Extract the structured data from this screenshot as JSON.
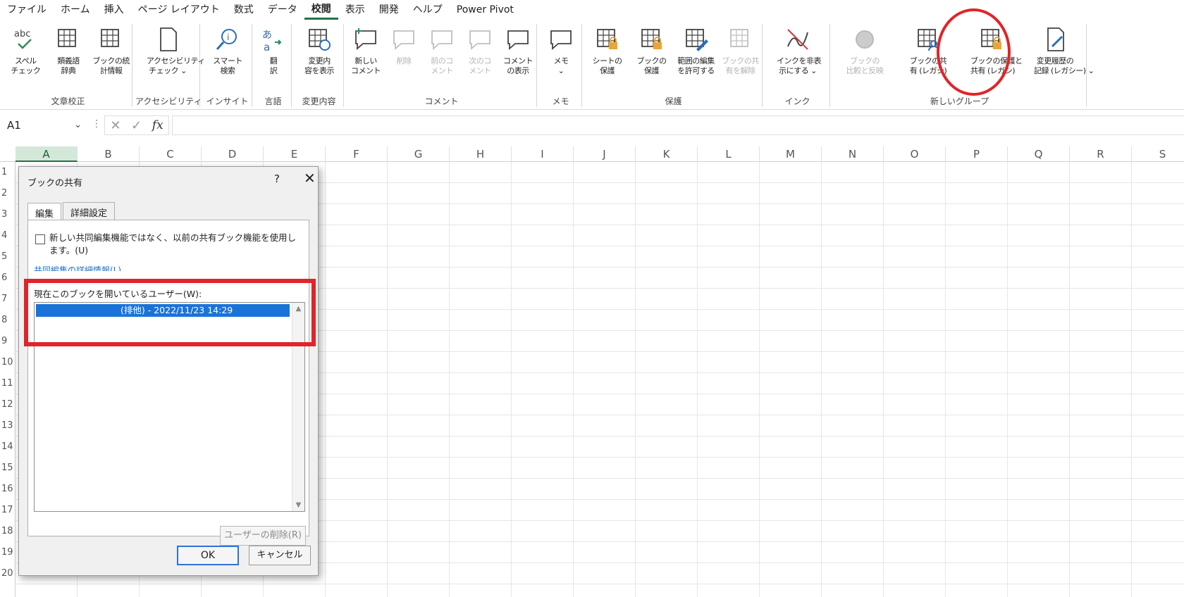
{
  "menubar": {
    "tabs": [
      "ファイル",
      "ホーム",
      "挿入",
      "ページ レイアウト",
      "数式",
      "データ",
      "校閲",
      "表示",
      "開発",
      "ヘルプ",
      "Power Pivot"
    ],
    "active_tab": "校閲"
  },
  "ribbon": {
    "groups": [
      {
        "label": "文章校正",
        "buttons": [
          {
            "label1": "スペル",
            "label2": "チェック",
            "icon": "abc-check-icon"
          },
          {
            "label1": "類義語",
            "label2": "辞典",
            "icon": "thesaurus-icon"
          },
          {
            "label1": "ブックの統",
            "label2": "計情報",
            "icon": "workbook-stats-icon"
          }
        ]
      },
      {
        "label": "アクセシビリティ",
        "buttons": [
          {
            "label1": "アクセシビリティ",
            "label2": "チェック ⌄",
            "icon": "accessibility-icon"
          }
        ]
      },
      {
        "label": "インサイト",
        "buttons": [
          {
            "label1": "スマート",
            "label2": "検索",
            "icon": "smart-lookup-icon"
          }
        ]
      },
      {
        "label": "言語",
        "buttons": [
          {
            "label1": "翻",
            "label2": "訳",
            "icon": "translate-icon"
          }
        ]
      },
      {
        "label": "変更内容",
        "buttons": [
          {
            "label1": "変更内",
            "label2": "容を表示",
            "icon": "show-changes-icon"
          }
        ]
      },
      {
        "label": "コメント",
        "buttons": [
          {
            "label1": "新しい",
            "label2": "コメント",
            "icon": "new-comment-icon"
          },
          {
            "label1": "削除",
            "label2": "",
            "icon": "delete-comment-icon",
            "disabled": true
          },
          {
            "label1": "前のコ",
            "label2": "メント",
            "icon": "prev-comment-icon",
            "disabled": true
          },
          {
            "label1": "次のコ",
            "label2": "メント",
            "icon": "next-comment-icon",
            "disabled": true
          },
          {
            "label1": "コメント",
            "label2": "の表示",
            "icon": "show-comments-icon"
          }
        ]
      },
      {
        "label": "メモ",
        "buttons": [
          {
            "label1": "メモ",
            "label2": "⌄",
            "icon": "notes-icon"
          }
        ]
      },
      {
        "label": "保護",
        "buttons": [
          {
            "label1": "シートの",
            "label2": "保護",
            "icon": "protect-sheet-icon"
          },
          {
            "label1": "ブックの",
            "label2": "保護",
            "icon": "protect-workbook-icon"
          },
          {
            "label1": "範囲の編集",
            "label2": "を許可する",
            "icon": "allow-edit-ranges-icon"
          },
          {
            "label1": "ブックの共",
            "label2": "有を解除",
            "icon": "unshare-workbook-icon",
            "disabled": true
          }
        ]
      },
      {
        "label": "インク",
        "buttons": [
          {
            "label1": "インクを非表",
            "label2": "示にする ⌄",
            "icon": "hide-ink-icon"
          }
        ]
      },
      {
        "label": "新しいグループ",
        "buttons": [
          {
            "label1": "ブックの",
            "label2": "比較と反映",
            "icon": "compare-merge-icon",
            "disabled": true
          },
          {
            "label1": "ブックの共",
            "label2": "有 (レガシ)",
            "icon": "share-workbook-legacy-icon"
          },
          {
            "label1": "ブックの保護と",
            "label2": "共有 (レガシ)",
            "icon": "protect-share-legacy-icon"
          },
          {
            "label1": "変更履歴の",
            "label2": "記録 (レガシー) ⌄",
            "icon": "track-changes-legacy-icon"
          }
        ]
      }
    ]
  },
  "formula_bar": {
    "name_box": "A1",
    "fx": "fx",
    "value": ""
  },
  "grid": {
    "columns": [
      "A",
      "B",
      "C",
      "D",
      "E",
      "F",
      "G",
      "H",
      "I",
      "J",
      "K",
      "L",
      "M",
      "N",
      "O",
      "P",
      "Q",
      "R",
      "S"
    ],
    "rows": [
      "1",
      "2",
      "3",
      "4",
      "5",
      "6",
      "7",
      "8",
      "9",
      "10",
      "11",
      "12",
      "13",
      "14",
      "15",
      "16",
      "17",
      "18",
      "19",
      "20"
    ]
  },
  "dialog": {
    "title": "ブックの共有",
    "help": "?",
    "close": "✕",
    "tabs": [
      "編集",
      "詳細設定"
    ],
    "checkbox_label": "新しい共同編集機能ではなく、以前の共有ブック機能を使用します。(U)",
    "link": "共同編集の詳細情報(L)",
    "users_label": "現在このブックを開いているユーザー(W):",
    "users": [
      "(排他) - 2022/11/23 14:29"
    ],
    "remove_user": "ユーザーの削除(R)",
    "ok": "OK",
    "cancel": "キャンセル"
  },
  "colors": {
    "accent": "#217346",
    "highlight_red": "#e0242a",
    "selection_blue": "#1a73d9"
  }
}
